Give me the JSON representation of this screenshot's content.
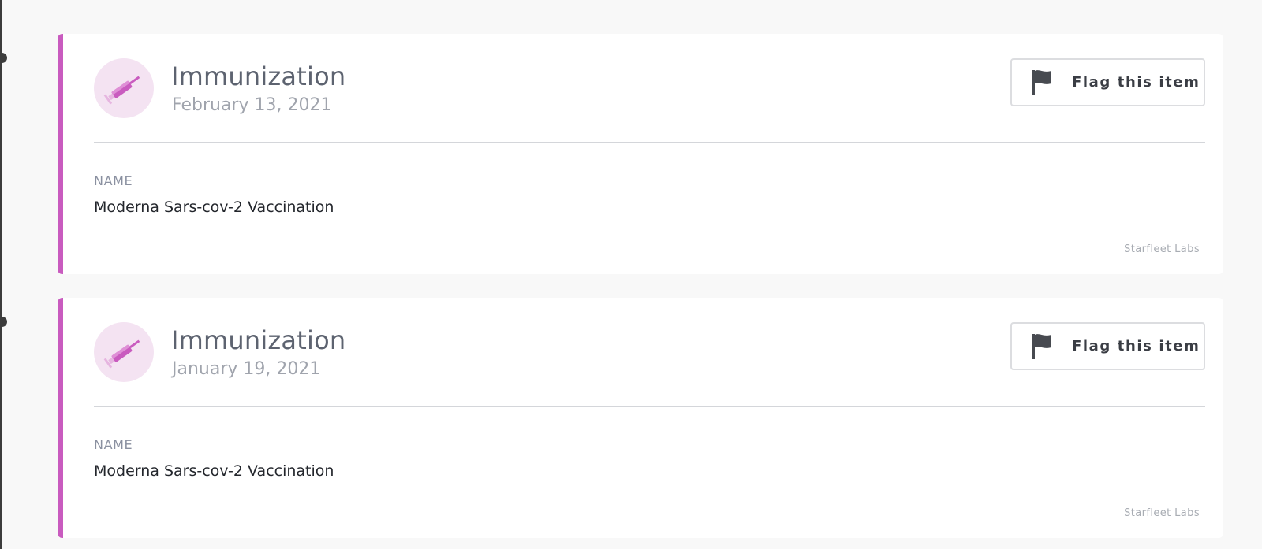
{
  "colors": {
    "accent": "#c95bbf",
    "icon_bg": "#f4e3f2",
    "timeline": "#3c3c3c"
  },
  "records": [
    {
      "icon": "syringe-icon",
      "title": "Immunization",
      "date": "February 13, 2021",
      "flag_label": "Flag this item",
      "flag_icon": "flag-icon",
      "field_label": "NAME",
      "field_value": "Moderna Sars-cov-2 Vaccination",
      "source": "Starfleet Labs"
    },
    {
      "icon": "syringe-icon",
      "title": "Immunization",
      "date": "January 19, 2021",
      "flag_label": "Flag this item",
      "flag_icon": "flag-icon",
      "field_label": "NAME",
      "field_value": "Moderna Sars-cov-2 Vaccination",
      "source": "Starfleet Labs"
    }
  ]
}
